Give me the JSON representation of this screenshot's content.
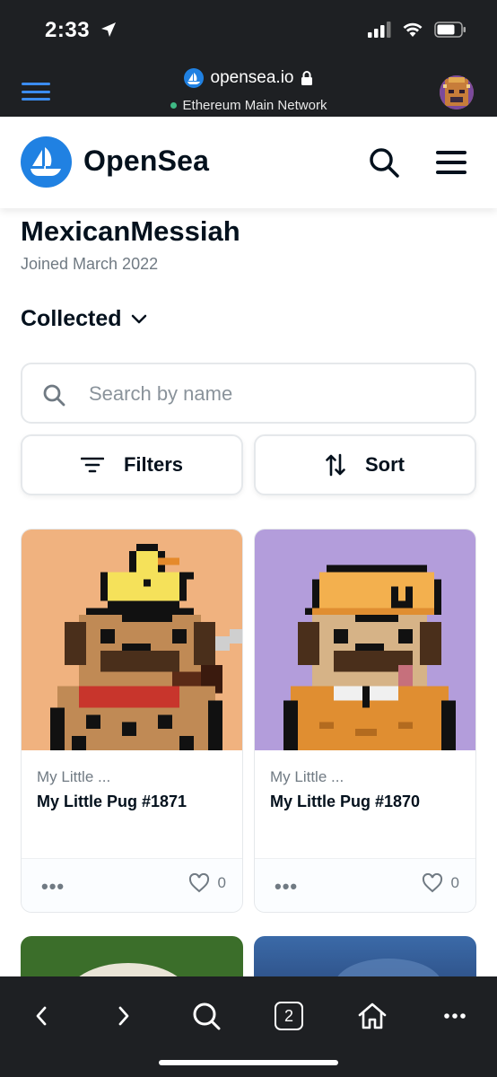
{
  "status_bar": {
    "time": "2:33"
  },
  "browser": {
    "url": "opensea.io",
    "network": "Ethereum Main Network",
    "tab_count": "2"
  },
  "header": {
    "brand": "OpenSea"
  },
  "profile": {
    "username": "MexicanMessiah",
    "joined": "Joined March 2022",
    "section": "Collected"
  },
  "search": {
    "placeholder": "Search by name"
  },
  "controls": {
    "filters_label": "Filters",
    "sort_label": "Sort"
  },
  "items": [
    {
      "collection": "My Little ...",
      "name": "My Little Pug #1871",
      "favorites": "0",
      "more": "•••",
      "bg_color": "#f0b27f"
    },
    {
      "collection": "My Little ...",
      "name": "My Little Pug #1870",
      "favorites": "0",
      "more": "•••",
      "bg_color": "#b39ddb"
    }
  ],
  "colors": {
    "accent": "#2081e2",
    "chrome": "#1e2023",
    "text": "#04111d",
    "muted": "#707a83"
  }
}
